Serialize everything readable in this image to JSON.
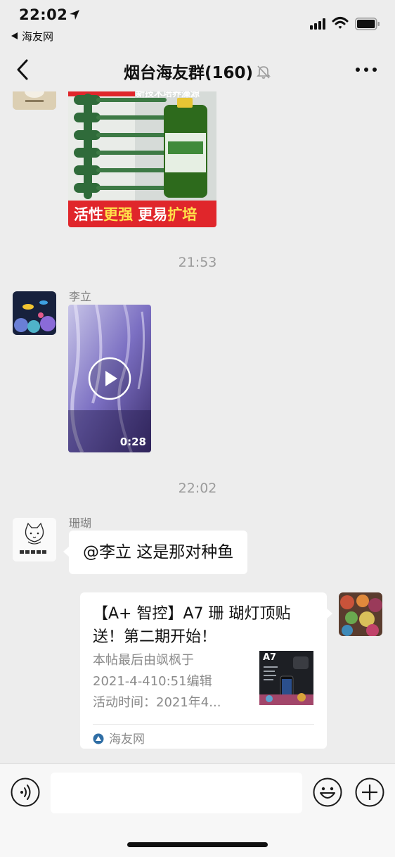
{
  "status_bar": {
    "time": "22:02",
    "back_app": "海友网",
    "icons": [
      "location-arrow-icon",
      "signal-icon",
      "wifi-icon",
      "battery-icon"
    ]
  },
  "nav": {
    "title": "烟台海友群(160)",
    "icons": [
      "back-chevron-icon",
      "mute-bell-icon",
      "more-dots-icon"
    ]
  },
  "chat": {
    "ad_image": {
      "top_text": "新技术培养藻源",
      "bottom_text_1": "活性",
      "bottom_text_2": "更强",
      "bottom_text_3": "更易",
      "bottom_text_4": "扩培"
    },
    "timestamp_1": "21:53",
    "sender_1": "李立",
    "video_duration": "0:28",
    "timestamp_2": "22:02",
    "sender_2": "珊瑚",
    "message_text": "@李立  这是那对种鱼",
    "link_card": {
      "title": "【A+ 智控】A7 珊 瑚灯顶贴送！第二期开始！",
      "desc_lines": [
        "本帖最后由飒枫于",
        "2021-4-410:51编辑",
        "活动时间：2021年4..."
      ],
      "thumb_label": "A7",
      "source": "海友网"
    }
  },
  "input_bar": {
    "placeholder": "",
    "icons": [
      "voice-icon",
      "emoji-icon",
      "plus-icon"
    ]
  },
  "colors": {
    "background": "#ededed",
    "bubble": "#ffffff",
    "timestamp": "#9b9b9b",
    "ad_red": "#e0262b"
  }
}
